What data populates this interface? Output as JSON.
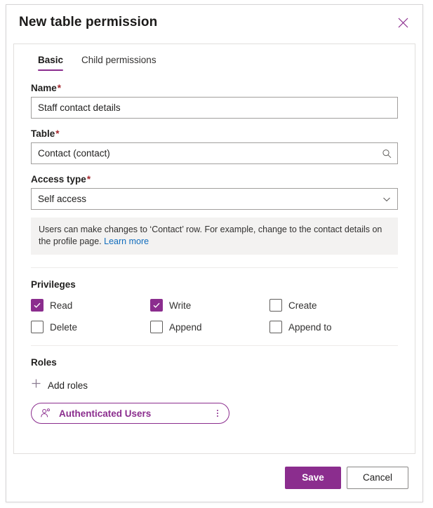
{
  "dialog": {
    "title": "New table permission",
    "close_icon": "close-icon"
  },
  "tabs": [
    {
      "label": "Basic",
      "active": true
    },
    {
      "label": "Child permissions",
      "active": false
    }
  ],
  "fields": {
    "name": {
      "label": "Name",
      "required_marker": "*",
      "value": "Staff contact details",
      "placeholder": ""
    },
    "table": {
      "label": "Table",
      "required_marker": "*",
      "value": "Contact (contact)",
      "placeholder": "",
      "icon": "search-icon"
    },
    "access_type": {
      "label": "Access type",
      "required_marker": "*",
      "value": "Self access",
      "icon": "chevron-down-icon"
    }
  },
  "info_banner": {
    "text": "Users can make changes to ‘Contact’ row. For example, change to the contact details on the profile page.",
    "link_label": "Learn more"
  },
  "privileges": {
    "title": "Privileges",
    "items": [
      {
        "label": "Read",
        "checked": true
      },
      {
        "label": "Write",
        "checked": true
      },
      {
        "label": "Create",
        "checked": false
      },
      {
        "label": "Delete",
        "checked": false
      },
      {
        "label": "Append",
        "checked": false
      },
      {
        "label": "Append to",
        "checked": false
      }
    ]
  },
  "roles": {
    "title": "Roles",
    "add_label": "Add roles",
    "add_icon": "plus-icon",
    "chips": [
      {
        "label": "Authenticated Users",
        "icon": "person-icon",
        "menu_icon": "kebab-menu-icon"
      }
    ]
  },
  "footer": {
    "save_label": "Save",
    "cancel_label": "Cancel"
  },
  "colors": {
    "accent": "#8b2d8e",
    "link": "#0f6cbd",
    "required": "#a4262c",
    "banner_bg": "#f3f2f1"
  }
}
